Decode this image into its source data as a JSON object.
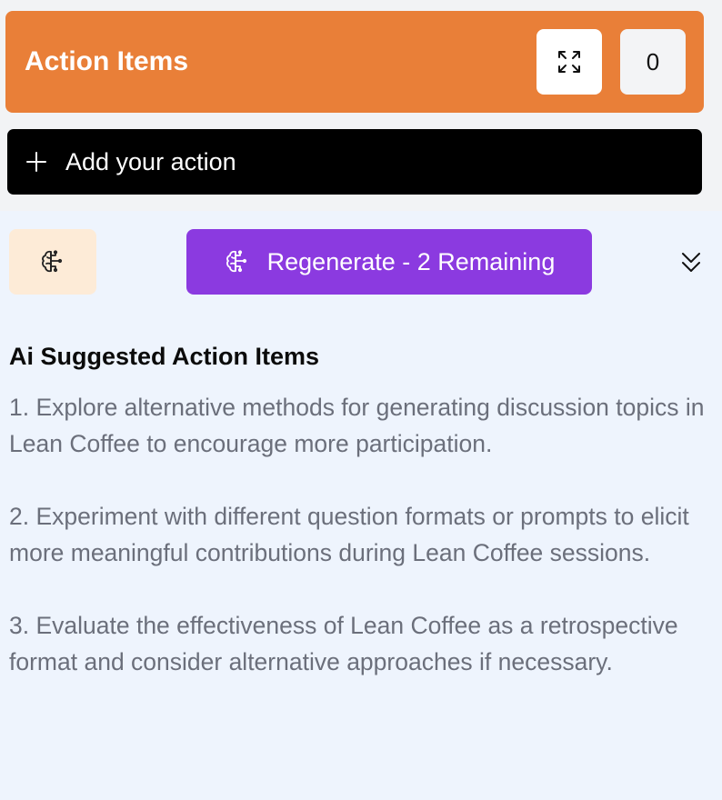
{
  "header": {
    "title": "Action Items",
    "expand_icon": "expand-arrows-icon",
    "count": "0"
  },
  "add_action": {
    "label": "Add your action",
    "icon": "plus-icon"
  },
  "ai_controls": {
    "ai_icon": "brain-icon",
    "regenerate_label": "Regenerate - 2 Remaining",
    "collapse_icon": "double-chevron-down-icon"
  },
  "suggestions": {
    "title": "Ai Suggested Action Items",
    "items": [
      "1. Explore alternative methods for generating discussion topics in Lean Coffee to encourage more participation.",
      "2. Experiment with different question formats or prompts to elicit more meaningful contributions during Lean Coffee sessions.",
      "3. Evaluate the effectiveness of Lean Coffee as a retrospective format and consider alternative approaches if necessary."
    ]
  },
  "colors": {
    "header_bg": "#e97f38",
    "add_action_bg": "#000000",
    "regenerate_bg": "#8b3ae0",
    "ai_icon_bg": "#fdebd7",
    "panel_bg": "#eef4fd",
    "suggestion_text": "#6b6f7b"
  }
}
